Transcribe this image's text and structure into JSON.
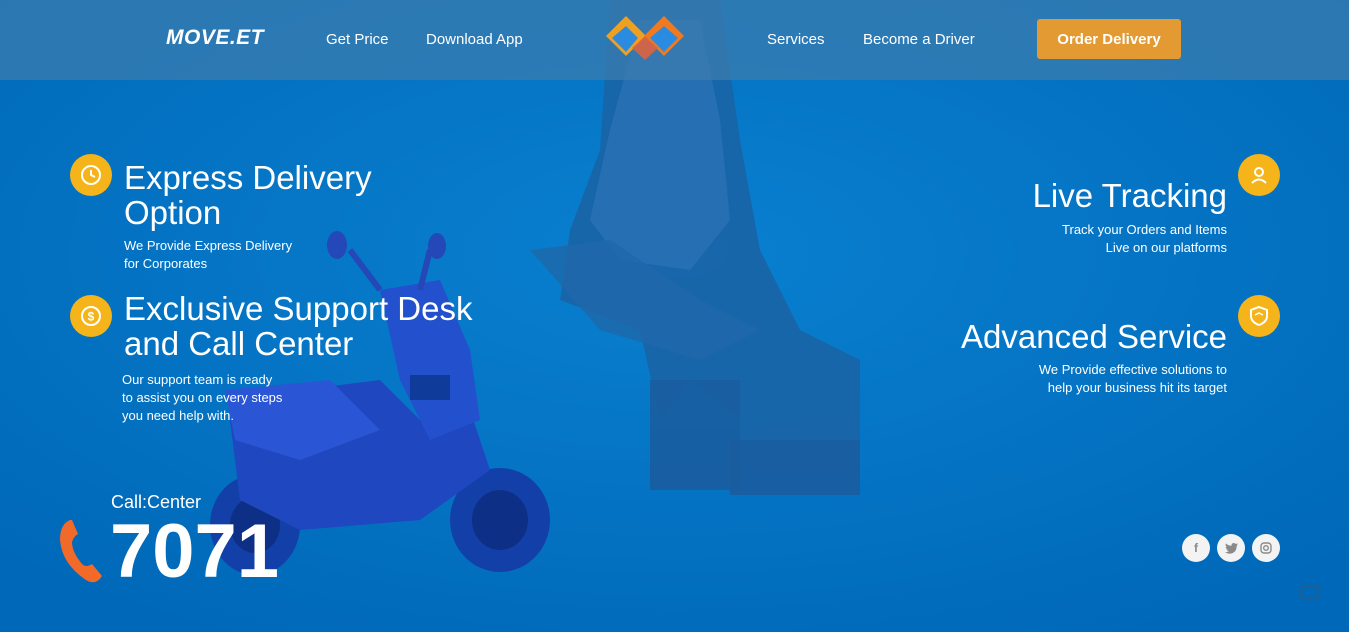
{
  "nav": {
    "brand": "MOVE.ET",
    "links": [
      "Get Price",
      "Download App",
      "Services",
      "Become a Driver"
    ],
    "order_button": "Order Delivery"
  },
  "features": {
    "express": {
      "title_line1": "Express Delivery",
      "title_line2": "Option",
      "desc_line1": "We Provide Express Delivery",
      "desc_line2": "for Corporates",
      "icon": "clock-icon"
    },
    "support": {
      "title_line1": "Exclusive Support Desk",
      "title_line2": "and Call Center",
      "desc_line1": "Our support team is ready",
      "desc_line2": "to assist you on every steps",
      "desc_line3": "you need help with.",
      "icon": "dollar-icon"
    },
    "tracking": {
      "title": "Live Tracking",
      "desc_line1": "Track your Orders and Items",
      "desc_line2": "Live on our platforms",
      "icon": "user-icon"
    },
    "advanced": {
      "title": "Advanced Service",
      "desc_line1": "We Provide effective solutions to",
      "desc_line2": "help your business hit its target",
      "icon": "shield-icon"
    }
  },
  "call_center": {
    "label": "Call:Center",
    "number": "7071"
  },
  "social": [
    "facebook-icon",
    "twitter-icon",
    "instagram-icon"
  ],
  "colors": {
    "background": "#0077c8",
    "accent": "#f5b41a",
    "button": "#e39a33",
    "phone": "#f26a2a"
  }
}
